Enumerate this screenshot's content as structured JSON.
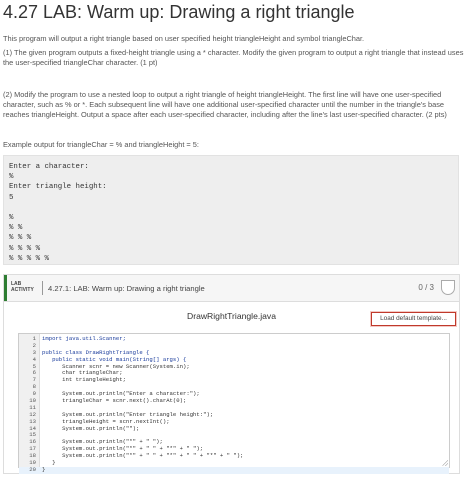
{
  "page": {
    "title": "4.27 LAB: Warm up: Drawing a right triangle",
    "intro": "This program will output a right triangle based on user specified height triangleHeight and symbol triangleChar.",
    "step1": "(1) The given program outputs a fixed-height triangle using a * character. Modify the given program to output a right triangle that instead uses the user-specified triangleChar character. (1 pt)",
    "step2": "(2) Modify the program to use a nested loop to output a right triangle of height triangleHeight. The first line will have one user-specified character, such as % or *. Each subsequent line will have one additional user-specified character until the number in the triangle's base reaches triangleHeight. Output a space after each user-specified character, including after the line's last user-specified character. (2 pts)",
    "example_caption": "Example output for triangleChar = % and triangleHeight = 5:"
  },
  "sample_output": [
    "Enter a character:",
    "%",
    "Enter triangle height:",
    "5",
    "",
    "%",
    "% %",
    "% % %",
    "% % % %",
    "% % % % %"
  ],
  "lab": {
    "tag_line1": "LAB",
    "tag_line2": "ACTIVITY",
    "title": "4.27.1: LAB: Warm up: Drawing a right triangle",
    "score": "0 / 3",
    "filename": "DrawRightTriangle.java",
    "load_button": "Load default template...",
    "accent_color": "#2e7d32"
  },
  "code_lines": [
    "import java.util.Scanner;",
    "",
    "public class DrawRightTriangle {",
    "   public static void main(String[] args) {",
    "      Scanner scnr = new Scanner(System.in);",
    "      char triangleChar;",
    "      int triangleHeight;",
    "",
    "      System.out.println(\"Enter a character:\");",
    "      triangleChar = scnr.next().charAt(0);",
    "",
    "      System.out.println(\"Enter triangle height:\");",
    "      triangleHeight = scnr.nextInt();",
    "      System.out.println(\"\");",
    "",
    "      System.out.println(\"*\" + \" \");",
    "      System.out.println(\"*\" + \" \" + \"*\" + \" \");",
    "      System.out.println(\"*\" + \" \" + \"*\" + \" \" + \"*\" + \" \");",
    "   }",
    "}"
  ],
  "code_line_numbers": [
    "1",
    "2",
    "3",
    "4",
    "5",
    "6",
    "7",
    "8",
    "9",
    "10",
    "11",
    "12",
    "13",
    "14",
    "15",
    "16",
    "17",
    "18",
    "19",
    "20"
  ]
}
